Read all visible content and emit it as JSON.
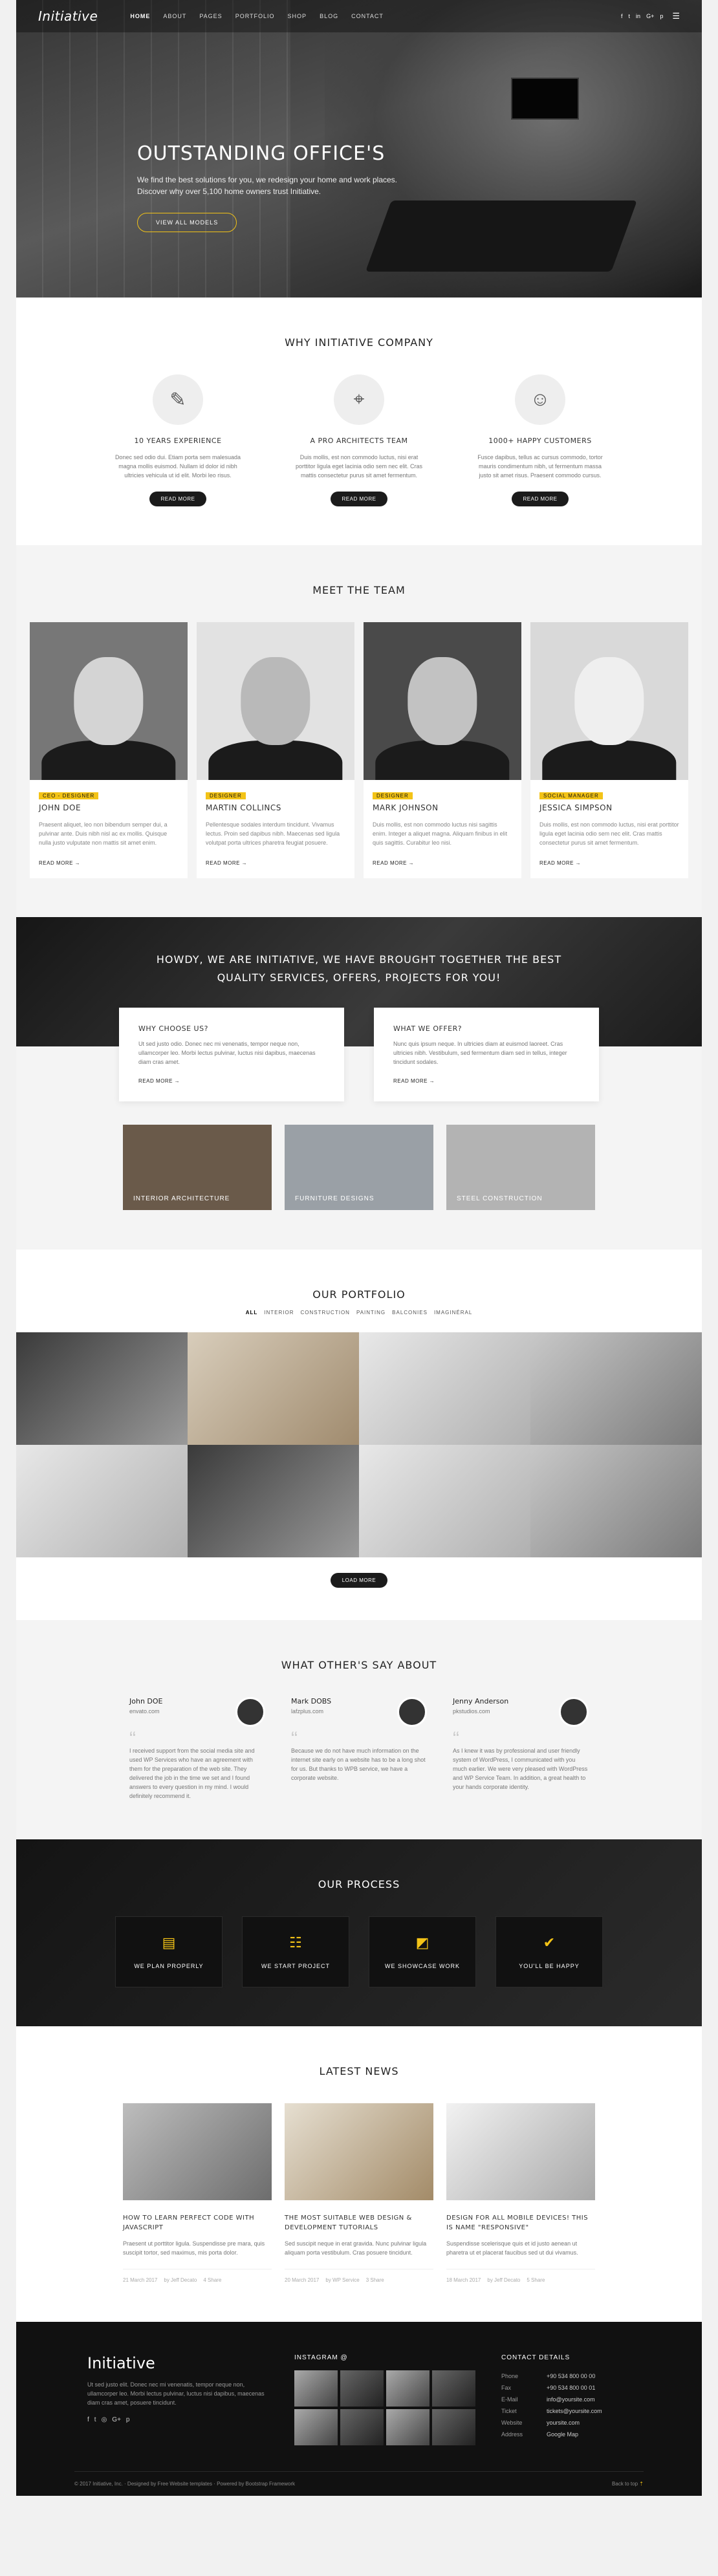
{
  "nav": {
    "logo": "Initiative",
    "items": [
      "Home",
      "About",
      "Pages",
      "Portfolio",
      "Shop",
      "Blog",
      "Contact"
    ],
    "social": [
      "f",
      "t",
      "in",
      "G+",
      "p"
    ]
  },
  "hero": {
    "title": "OUTSTANDING OFFICE'S",
    "text": "We find the best solutions for you, we redesign your home and work places. Discover why over 5,100 home owners trust Initiative.",
    "button": "View all models"
  },
  "why": {
    "title": "WHY INITIATIVE COMPANY",
    "items": [
      {
        "title": "10 YEARS EXPERIENCE",
        "text": "Donec sed odio dui. Etiam porta sem malesuada magna mollis euismod. Nullam id dolor id nibh ultricies vehicula ut id elit. Morbi leo risus.",
        "button": "Read more",
        "icon": "pencil-icon"
      },
      {
        "title": "A PRO ARCHITECTS TEAM",
        "text": "Duis mollis, est non commodo luctus, nisi erat porttitor ligula eget lacinia odio sem nec elit. Cras mattis consectetur purus sit amet fermentum.",
        "button": "Read more",
        "icon": "compass-icon"
      },
      {
        "title": "1000+ HAPPY CUSTOMERS",
        "text": "Fusce dapibus, tellus ac cursus commodo, tortor mauris condimentum nibh, ut fermentum massa justo sit amet risus. Praesent commodo cursus.",
        "button": "Read more",
        "icon": "smile-icon"
      }
    ]
  },
  "team": {
    "title": "MEET THE TEAM",
    "members": [
      {
        "role": "CEO - DESIGNER",
        "name": "JOHN DOE",
        "text": "Praesent aliquet, leo non bibendum semper dui, a pulvinar ante. Duis nibh nisl ac ex mollis. Quisque nulla justo vulputate non mattis sit amet enim.",
        "link": "Read more"
      },
      {
        "role": "DESIGNER",
        "name": "MARTIN COLLINCS",
        "text": "Pellentesque sodales interdum tincidunt. Vivamus lectus. Proin sed dapibus nibh. Maecenas sed ligula volutpat porta ultrices pharetra feugiat posuere.",
        "link": "Read more"
      },
      {
        "role": "DESIGNER",
        "name": "MARK JOHNSON",
        "text": "Duis mollis, est non commodo luctus nisi sagittis enim. Integer a aliquet magna. Aliquam finibus in elit quis sagittis. Curabitur leo nisi.",
        "link": "Read more"
      },
      {
        "role": "SOCIAL MANAGER",
        "name": "JESSICA SIMPSON",
        "text": "Duis mollis, est non commodo luctus, nisi erat porttitor ligula eget lacinia odio sem nec elit. Cras mattis consectetur purus sit amet fermentum.",
        "link": "Read more"
      }
    ]
  },
  "howdy": {
    "title": "HOWDY, WE ARE INITIATIVE, WE HAVE BROUGHT TOGETHER THE BEST QUALITY SERVICES, OFFERS, PROJECTS FOR YOU!",
    "boxes": [
      {
        "title": "WHY CHOOSE US?",
        "text": "Ut sed justo odio. Donec nec mi venenatis, tempor neque non, ullamcorper leo. Morbi lectus pulvinar, luctus nisi dapibus, maecenas diam cras amet.",
        "link": "Read more"
      },
      {
        "title": "WHAT WE OFFER?",
        "text": "Nunc quis ipsum neque. In ultricies diam at euismod laoreet. Cras ultricies nibh. Vestibulum, sed fermentum diam sed in tellus, integer tincidunt sodales.",
        "link": "Read more"
      }
    ],
    "categories": [
      "Interior Architecture",
      "Furniture Designs",
      "Steel Construction"
    ]
  },
  "portfolio": {
    "title": "OUR PORTFOLIO",
    "filters": [
      "All",
      "Interior",
      "Construction",
      "Painting",
      "Balconies",
      "Imaginéral"
    ],
    "button": "Load more"
  },
  "testimonials": {
    "title": "WHAT OTHER'S SAY ABOUT",
    "items": [
      {
        "name": "John DOE",
        "site": "envato.com",
        "text": "I received support from the social media site and used WP Services who have an agreement with them for the preparation of the web site. They delivered the job in the time we set and I found answers to every question in my mind. I would definitely recommend it."
      },
      {
        "name": "Mark DOBS",
        "site": "lafzplus.com",
        "text": "Because we do not have much information on the internet site early on a website has to be a long shot for us. But thanks to WPB service, we have a corporate website."
      },
      {
        "name": "Jenny Anderson",
        "site": "pkstudios.com",
        "text": "As I knew it was by professional and user friendly system of WordPress, I communicated with you much earlier. We were very pleased with WordPress and WP Service Team. In addition, a great health to your hands corporate identity."
      }
    ]
  },
  "process": {
    "title": "OUR PROCESS",
    "steps": [
      {
        "label": "WE PLAN PROPERLY",
        "icon": "plan-icon"
      },
      {
        "label": "WE START PROJECT",
        "icon": "team-icon"
      },
      {
        "label": "WE SHOWCASE WORK",
        "icon": "ruler-icon"
      },
      {
        "label": "YOU'LL BE HAPPY",
        "icon": "thumb-icon"
      }
    ]
  },
  "news": {
    "title": "LATEST NEWS",
    "posts": [
      {
        "title": "HOW TO LEARN PERFECT CODE WITH JAVASCRIPT",
        "text": "Praesent ut porttitor ligula. Suspendisse pre mara, quis suscipit tortor, sed maximus, mis porta dolor.",
        "date": "21 March 2017",
        "author": "by Jeff Decato",
        "comments": "4 Share"
      },
      {
        "title": "THE MOST SUITABLE WEB DESIGN & DEVELOPMENT TUTORIALS",
        "text": "Sed suscipit neque in erat gravida. Nunc pulvinar ligula aliquam porta vestibulum. Cras posuere tincidunt.",
        "date": "20 March 2017",
        "author": "by WP Service",
        "comments": "3 Share"
      },
      {
        "title": "DESIGN FOR ALL MOBILE DEVICES! THIS IS NAME \"RESPONSIVE\"",
        "text": "Suspendisse scelerisque quis et id justo aenean ut pharetra ut et placerat faucibus sed ut dui vivamus.",
        "date": "18 March 2017",
        "author": "by Jeff Decato",
        "comments": "5 Share"
      }
    ]
  },
  "footer": {
    "logo": "Initiative",
    "text": "Ut sed justo elit. Donec nec mi venenatis, tempor neque non, ullamcorper leo. Morbi lectus pulvinar, luctus nisi dapibus, maecenas diam cras amet, posuere tincidunt.",
    "instagram_title": "INSTAGRAM @",
    "contact_title": "CONTACT DETAILS",
    "contact": [
      {
        "k": "Phone",
        "v": "+90 534 800 00 00"
      },
      {
        "k": "Fax",
        "v": "+90 534 800 00 01"
      },
      {
        "k": "E-Mail",
        "v": "info@yoursite.com"
      },
      {
        "k": "Ticket",
        "v": "tickets@yoursite.com"
      },
      {
        "k": "Website",
        "v": "yoursite.com"
      },
      {
        "k": "Address",
        "v": "Google Map"
      }
    ],
    "copyright": "© 2017 Initiative, Inc.  ·  Designed by Free Website templates · Powered by Bootstrap Framework",
    "back_to_top": "Back to top"
  }
}
